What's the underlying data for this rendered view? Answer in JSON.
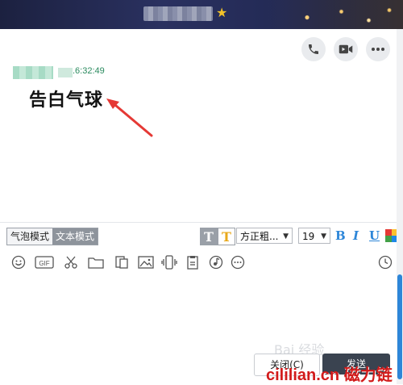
{
  "window": {
    "contact_name": "",
    "star_icon": "star-icon"
  },
  "header_actions": {
    "call_icon": "phone-icon",
    "video_icon": "video-camera-icon",
    "more_icon": "more-icon"
  },
  "message": {
    "time": ".6:32:49",
    "text": "告白气球"
  },
  "toolbar": {
    "bubble_mode": "气泡模式",
    "text_mode": "文本模式",
    "font_name": "方正粗...",
    "font_size": "19",
    "bold_label": "B",
    "italic_label": "I",
    "underline_label": "U",
    "text_style_label": "T",
    "text_color_label": "T"
  },
  "tools": [
    "emoji-icon",
    "gif-icon",
    "scissors-icon",
    "folder-icon",
    "doc-icon",
    "image-icon",
    "shake-icon",
    "clipboard-icon",
    "music-icon",
    "more-dots-icon",
    "history-clock-icon"
  ],
  "footer": {
    "close_label": "关闭(C)",
    "send_label": "发送"
  },
  "watermark": {
    "text": "cililian.cn 磁力链",
    "baidu": "Bai 经验"
  },
  "colors": {
    "accent_blue": "#2d86d8",
    "timestamp_green": "#2a8a5e",
    "send_button": "#3a4350",
    "watermark_red": "#d21b1b"
  }
}
